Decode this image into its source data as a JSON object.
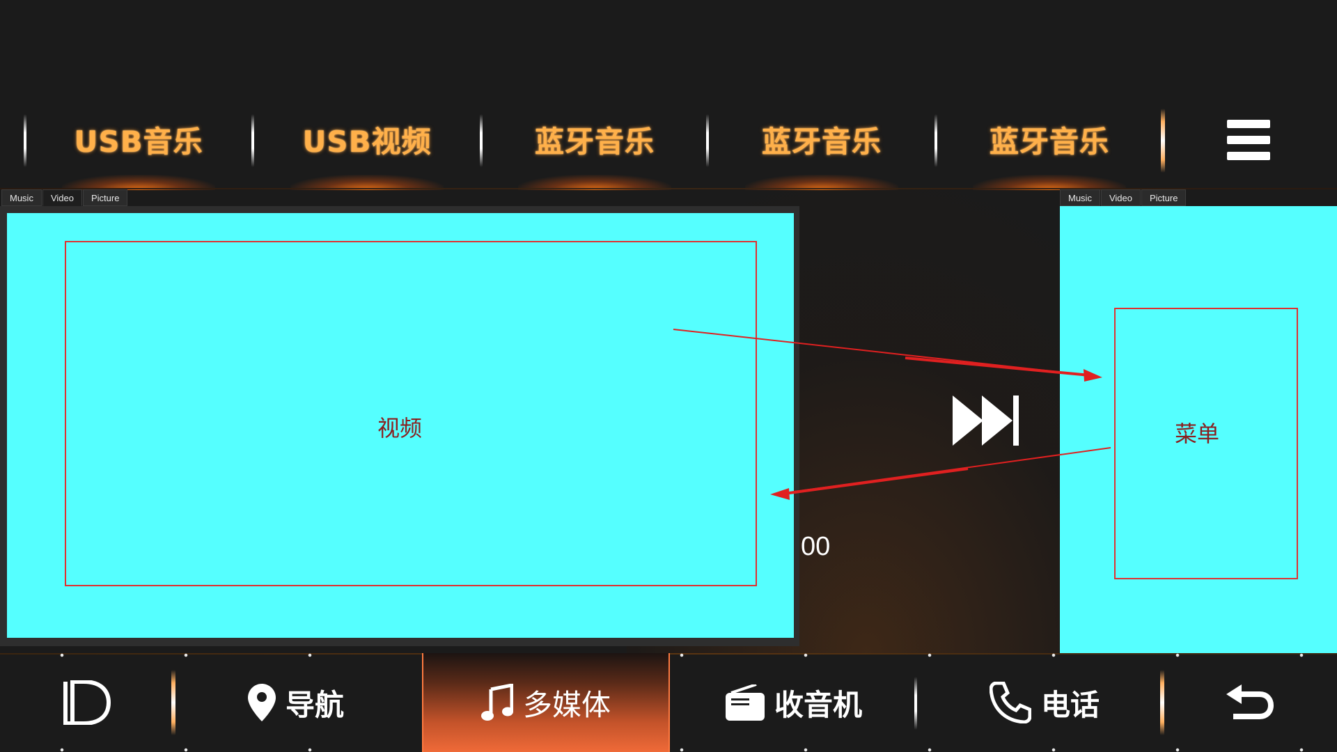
{
  "top_tabs": [
    {
      "label": "USB音乐"
    },
    {
      "label": "USB视频"
    },
    {
      "label": "蓝牙音乐"
    },
    {
      "label": "蓝牙音乐"
    },
    {
      "label": "蓝牙音乐"
    }
  ],
  "left_panel": {
    "tabs": [
      "Music",
      "Video",
      "Picture"
    ],
    "active_tab": "Video",
    "content_label": "视频"
  },
  "right_panel": {
    "tabs": [
      "Music",
      "Video",
      "Picture"
    ],
    "content_label": "菜单"
  },
  "player": {
    "time_text": "00",
    "fast_forward_icon": "fast-forward-icon"
  },
  "bottom_nav": [
    {
      "icon": "logo-icon",
      "label": ""
    },
    {
      "icon": "location-pin-icon",
      "label": "导航"
    },
    {
      "icon": "music-note-icon",
      "label": "多媒体",
      "active": true
    },
    {
      "icon": "radio-icon",
      "label": "收音机"
    },
    {
      "icon": "phone-icon",
      "label": "电话"
    },
    {
      "icon": "back-arrow-icon",
      "label": ""
    }
  ],
  "colors": {
    "background": "#1b1b1b",
    "tab_text": "#ffb04a",
    "panel_fill": "#55ffff",
    "annotation_red": "#e03030",
    "active_nav": "#ef6a38"
  }
}
